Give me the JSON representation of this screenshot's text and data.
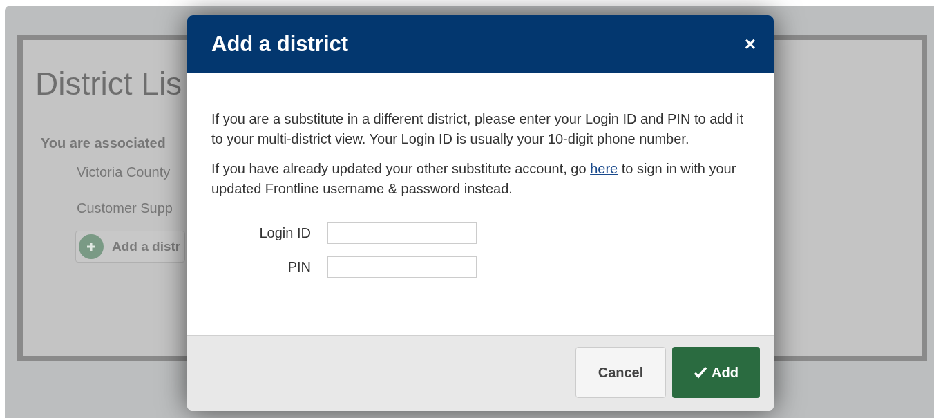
{
  "page": {
    "title": "District Lis",
    "associated_label": "You are associated",
    "districts": [
      "Victoria County",
      "Customer Supp"
    ],
    "add_button": "Add a distr"
  },
  "dialog": {
    "title": "Add a district",
    "close": "×",
    "paragraphs": [
      {
        "text": "If you are a substitute in a different district, please enter your Login ID and PIN to add it to your multi-district view. Your Login ID is usually your 10-digit phone number."
      },
      {
        "before": "If you have already updated your other substitute account, go ",
        "link": "here",
        "after": " to sign in with your updated Frontline username & password instead."
      }
    ],
    "fields": [
      {
        "label": "Login ID"
      },
      {
        "label": "PIN"
      }
    ],
    "buttons": [
      {
        "kind": "secondary",
        "label": "Cancel"
      },
      {
        "kind": "primary",
        "label": "Add"
      }
    ]
  }
}
